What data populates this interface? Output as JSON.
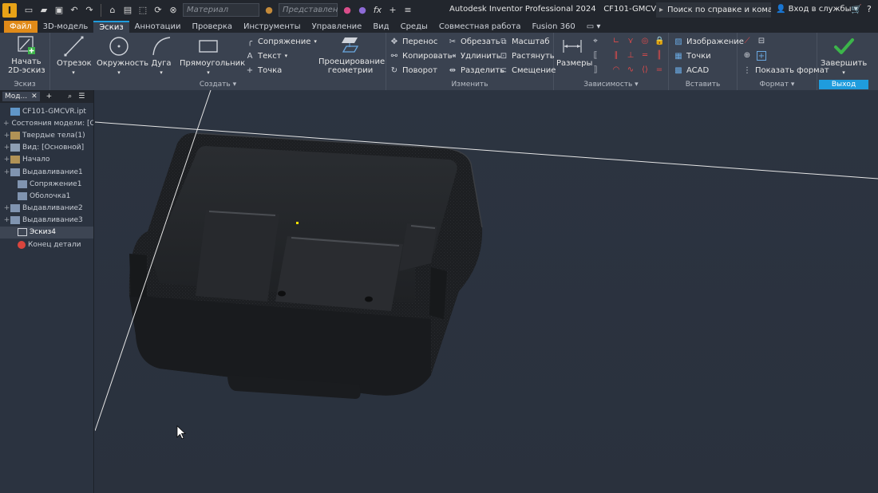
{
  "window": {
    "app_title": "Autodesk Inventor Professional 2024",
    "file_name": "CF101-GMCVR.ipt",
    "material_placeholder": "Материал",
    "appearance_placeholder": "Представлен",
    "help_search": "Поиск по справке и командам.",
    "sign_in": "Вход в службы",
    "app_letter": "I"
  },
  "tabs": [
    "Файл",
    "3D-модель",
    "Эскиз",
    "Аннотации",
    "Проверка",
    "Инструменты",
    "Управление",
    "Вид",
    "Среды",
    "Совместная работа",
    "Fusion 360"
  ],
  "active_tab": "Эскиз",
  "ribbon": {
    "sketch_panel": {
      "label": "Эскиз",
      "start_sketch": "Начать\n2D-эскиз",
      "start_line1": "Начать",
      "start_line2": "2D-эскиз"
    },
    "create_panel": {
      "label": "Создать",
      "line": "Отрезок",
      "circle": "Окружность",
      "arc": "Дуга",
      "rectangle": "Прямоугольник",
      "fillet": "Сопряжение",
      "text": "Текст",
      "point": "Точка",
      "project_line1": "Проецирование",
      "project_line2": "геометрии"
    },
    "modify_panel": {
      "label": "Изменить",
      "move": "Перенос",
      "copy": "Копировать",
      "rotate": "Поворот",
      "trim": "Обрезать",
      "extend": "Удлинить",
      "split": "Разделить",
      "scale": "Масштаб",
      "stretch": "Растянуть",
      "offset": "Смещение"
    },
    "constrain_panel": {
      "label": "Зависимость",
      "dimension": "Размеры"
    },
    "insert_panel": {
      "label": "Вставить",
      "image": "Изображение",
      "points": "Точки",
      "acad": "ACAD"
    },
    "format_panel": {
      "label": "Формат",
      "show_format": "Показать формат"
    },
    "exit_panel": {
      "label": "Выход",
      "finish": "Завершить"
    }
  },
  "browser": {
    "tab_label": "Мод...",
    "items": [
      {
        "label": "CF101-GMCVR.ipt",
        "expand": "",
        "indent": 0,
        "icon": "part-icon"
      },
      {
        "label": "Состояния модели: [О",
        "expand": "+",
        "indent": 0,
        "icon": "folder-icon"
      },
      {
        "label": "Твердые тела(1)",
        "expand": "+",
        "indent": 0,
        "icon": "folder-icon"
      },
      {
        "label": "Вид: [Основной]",
        "expand": "+",
        "indent": 0,
        "icon": "view-icon"
      },
      {
        "label": "Начало",
        "expand": "+",
        "indent": 0,
        "icon": "folder-icon"
      },
      {
        "label": "Выдавливание1",
        "expand": "+",
        "indent": 0,
        "icon": "extrude-icon"
      },
      {
        "label": "Сопряжение1",
        "expand": "",
        "indent": 1,
        "icon": "fillet-icon"
      },
      {
        "label": "Оболочка1",
        "expand": "",
        "indent": 1,
        "icon": "shell-icon"
      },
      {
        "label": "Выдавливание2",
        "expand": "+",
        "indent": 0,
        "icon": "extrude-icon"
      },
      {
        "label": "Выдавливание3",
        "expand": "+",
        "indent": 0,
        "icon": "extrude-icon"
      },
      {
        "label": "Эскиз4",
        "expand": "",
        "indent": 1,
        "icon": "sketch-icon",
        "selected": true
      },
      {
        "label": "Конец детали",
        "expand": "",
        "indent": 1,
        "icon": "end-of-part-icon"
      }
    ]
  },
  "colors": {
    "file_tab": "#e08a18",
    "accent": "#1f9cdd",
    "finish_check": "#3cb54a"
  }
}
